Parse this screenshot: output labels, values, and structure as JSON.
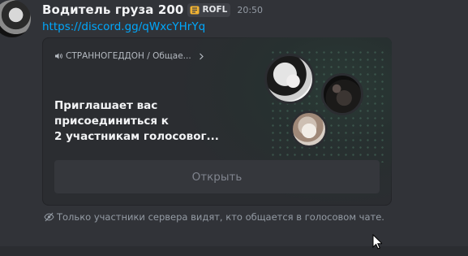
{
  "message": {
    "username": "Водитель груза 200",
    "tag": {
      "label": "ROFL",
      "icon": "rofl-badge-icon"
    },
    "timestamp": "20:50",
    "link": "https://discord.gg/qWxcYHrYq"
  },
  "invite_card": {
    "channel_path": "СТРАННОГЕДДОН / Общае...",
    "channel_icon": "speaker-icon",
    "invite_lines": [
      "Приглашает вас",
      "присоединиться к",
      "2 участникам голосовог..."
    ],
    "open_button_label": "Открыть",
    "avatars": [
      {
        "name": "participant-avatar-1"
      },
      {
        "name": "participant-avatar-2"
      },
      {
        "name": "participant-avatar-3"
      }
    ]
  },
  "notice": {
    "icon": "eye-slash-icon",
    "text": "Только участники сервера видят, кто общается в голосовом чате."
  },
  "colors": {
    "background": "#313338",
    "card": "#2b2d31",
    "link": "#00a8fc",
    "username": "#f2f3f5",
    "muted": "#949ba4",
    "button": "#35373c"
  }
}
